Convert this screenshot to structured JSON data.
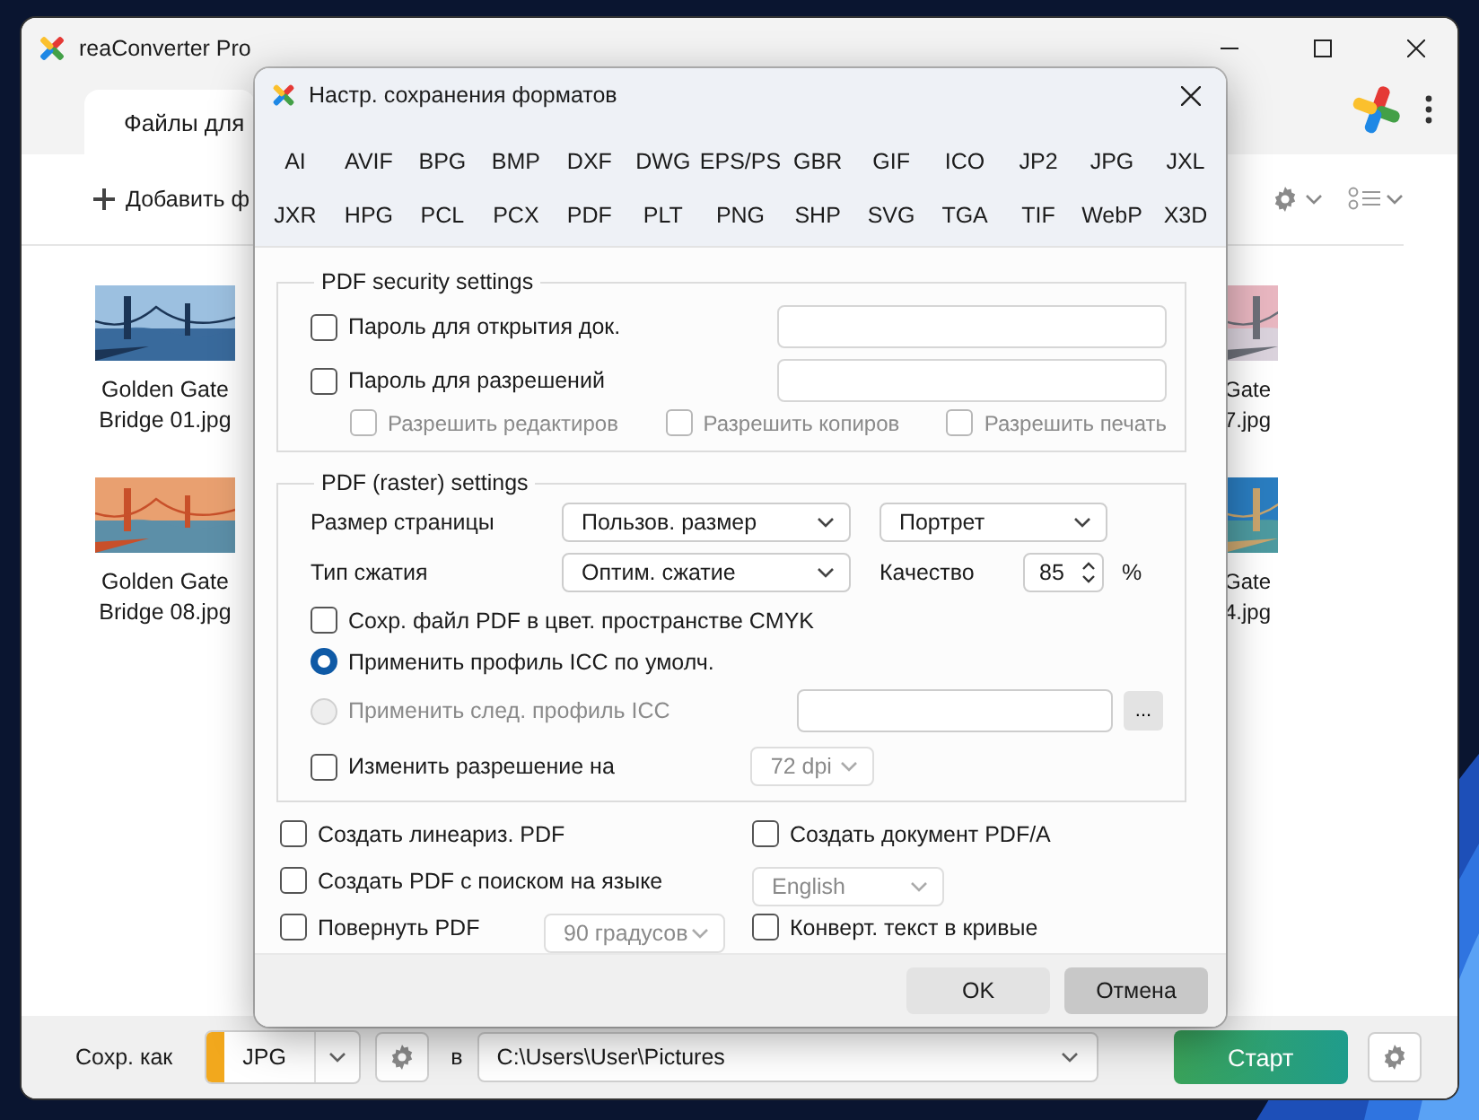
{
  "app": {
    "title": "reaConverter Pro",
    "tab": "Файлы для",
    "add_button": "Добавить ф",
    "files_left": [
      {
        "name": "Golden Gate Bridge 01.jpg",
        "kind": "fog"
      },
      {
        "name": "Golden Gate Bridge 08.jpg",
        "kind": "sunset"
      }
    ],
    "files_right": [
      {
        "name": "Gate 7.jpg",
        "kind": "pink"
      },
      {
        "name": "Gate 4.jpg",
        "kind": "beach"
      }
    ],
    "bottom": {
      "save_as_label": "Сохр. как",
      "format": "JPG",
      "in_label": "в",
      "path": "C:\\Users\\User\\Pictures",
      "start": "Старт"
    }
  },
  "dialog": {
    "title": "Настр. сохранения форматов",
    "formats": [
      "AI",
      "AVIF",
      "BPG",
      "BMP",
      "DXF",
      "DWG",
      "EPS/PS",
      "GBR",
      "GIF",
      "ICO",
      "JP2",
      "JPG",
      "JXL",
      "JXR",
      "HPG",
      "PCL",
      "PCX",
      "PDF",
      "PLT",
      "PNG",
      "SHP",
      "SVG",
      "TGA",
      "TIF",
      "WebP",
      "X3D"
    ],
    "security": {
      "legend": "PDF security settings",
      "passwords": [
        {
          "label": "Пароль для открытия док.",
          "checked": false
        },
        {
          "label": "Пароль для разрешений",
          "checked": false
        }
      ],
      "permissions": [
        {
          "label": "Разрешить редактиров",
          "checked": false,
          "disabled": true
        },
        {
          "label": "Разрешить копиров",
          "checked": false,
          "disabled": true
        },
        {
          "label": "Разрешить печать",
          "checked": false,
          "disabled": true
        }
      ]
    },
    "raster": {
      "legend": "PDF (raster) settings",
      "page_size_label": "Размер страницы",
      "page_size": {
        "value": "Пользов. размер",
        "disabled": false
      },
      "orientation": {
        "value": "Портрет",
        "disabled": false
      },
      "compression_label": "Тип сжатия",
      "compression": {
        "value": "Оптим. сжатие",
        "disabled": false
      },
      "quality_label": "Качество",
      "quality": "85",
      "percent": "%",
      "cmyk": {
        "label": "Сохр. файл PDF в цвет. пространстве CMYK",
        "checked": false
      },
      "icc": [
        {
          "label": "Применить профиль ICC по умолч.",
          "selected": true,
          "disabled": false
        },
        {
          "label": "Применить след. профиль ICC",
          "selected": false,
          "disabled": true
        }
      ],
      "browse": "...",
      "resolution": {
        "label": "Изменить разрешение на",
        "checked": false
      },
      "dpi": {
        "value": "72 dpi",
        "disabled": true
      }
    },
    "options": {
      "linearize": {
        "label": "Создать линеариз. PDF",
        "checked": false
      },
      "pdfa": {
        "label": "Создать документ PDF/A",
        "checked": false
      },
      "searchable": {
        "label": "Создать PDF с поиском на языке",
        "checked": false
      },
      "language": {
        "value": "English",
        "disabled": true
      },
      "rotate": {
        "label": "Повернуть PDF",
        "checked": false
      },
      "angle": {
        "value": "90 градусов",
        "disabled": true
      },
      "curves": {
        "label": "Конверт. текст в кривые",
        "checked": false
      }
    },
    "buttons": [
      {
        "label": "OK",
        "kind": "default"
      },
      {
        "label": "Отмена",
        "kind": "cancel"
      }
    ]
  }
}
